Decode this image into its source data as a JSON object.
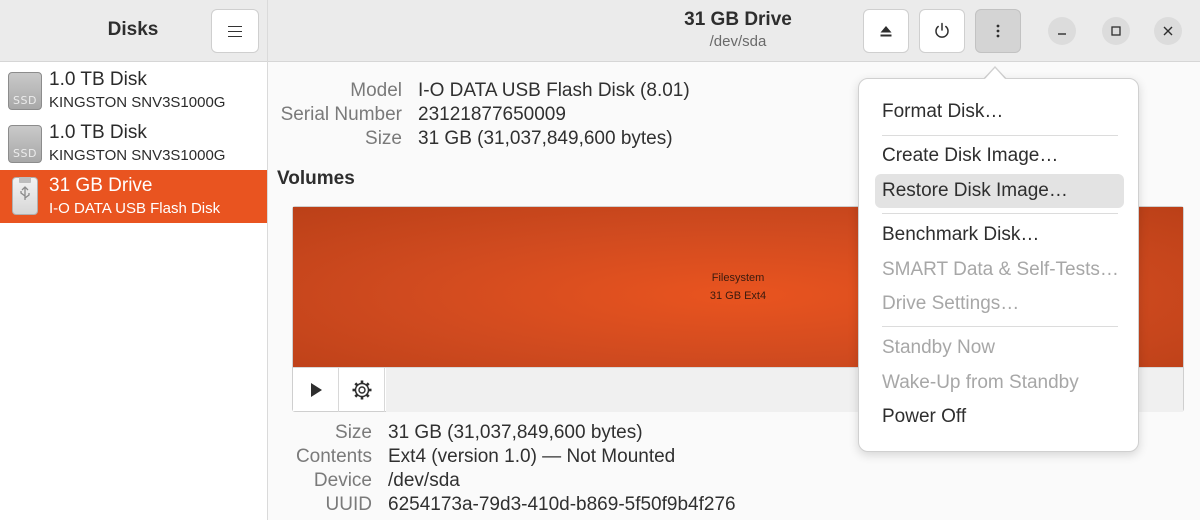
{
  "sidebar": {
    "title": "Disks",
    "disks": [
      {
        "name": "1.0 TB Disk",
        "subtitle": "KINGSTON SNV3S1000G",
        "icon": "ssd-icon",
        "icon_label": "SSD"
      },
      {
        "name": "1.0 TB Disk",
        "subtitle": "KINGSTON SNV3S1000G",
        "icon": "ssd-icon",
        "icon_label": "SSD"
      },
      {
        "name": "31 GB Drive",
        "subtitle": "I-O DATA USB Flash Disk",
        "icon": "usb-drive-icon",
        "selected": true
      }
    ]
  },
  "header": {
    "title": "31 GB Drive",
    "subtitle": "/dev/sda"
  },
  "drive": {
    "model_label": "Model",
    "model": "I-O DATA USB Flash Disk (8.01)",
    "serial_label": "Serial Number",
    "serial": "23121877650009",
    "size_label": "Size",
    "size": "31 GB (31,037,849,600 bytes)"
  },
  "volumes": {
    "heading": "Volumes",
    "partition_name": "Filesystem",
    "partition_desc": "31 GB Ext4"
  },
  "volume_details": {
    "size_label": "Size",
    "size": "31 GB (31,037,849,600 bytes)",
    "contents_label": "Contents",
    "contents": "Ext4 (version 1.0) — Not Mounted",
    "device_label": "Device",
    "device": "/dev/sda",
    "uuid_label": "UUID",
    "uuid": "6254173a-79d3-410d-b869-5f50f9b4f276"
  },
  "menu": {
    "format": "Format Disk…",
    "create_image": "Create Disk Image…",
    "restore_image": "Restore Disk Image…",
    "benchmark": "Benchmark Disk…",
    "smart": "SMART Data & Self-Tests…",
    "drive_settings": "Drive Settings…",
    "standby": "Standby Now",
    "wakeup": "Wake-Up from Standby",
    "power_off": "Power Off"
  },
  "colors": {
    "accent": "#e95420",
    "partition": "#d84c1e"
  }
}
